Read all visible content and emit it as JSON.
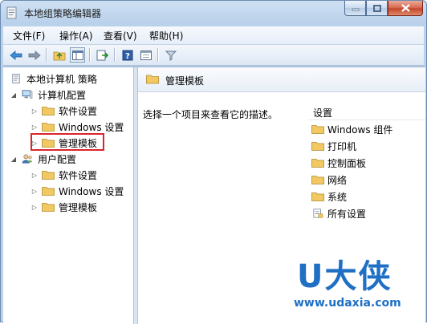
{
  "window": {
    "title": "本地组策略编辑器"
  },
  "menu": [
    {
      "label": "文件(F)"
    },
    {
      "label": "操作(A)"
    },
    {
      "label": "查看(V)"
    },
    {
      "label": "帮助(H)"
    }
  ],
  "toolbar": {
    "icons": [
      "back-arrow-icon",
      "forward-arrow-icon",
      "up-folder-icon",
      "show-hide-tree-icon",
      "export-list-icon",
      "help-icon",
      "properties-icon",
      "filter-icon"
    ]
  },
  "tree": {
    "root": "本地计算机 策略",
    "computer_config": "计算机配置",
    "computer_children": [
      "软件设置",
      "Windows 设置",
      "管理模板"
    ],
    "user_config": "用户配置",
    "user_children": [
      "软件设置",
      "Windows 设置",
      "管理模板"
    ]
  },
  "right": {
    "title": "管理模板",
    "description": "选择一个项目来查看它的描述。",
    "column_header": "设置",
    "items": [
      "Windows 组件",
      "打印机",
      "控制面板",
      "网络",
      "系统",
      "所有设置"
    ]
  },
  "watermark": {
    "big": "U大侠",
    "url": "www.udaxia.com"
  },
  "colors": {
    "highlight_border": "#d9252b",
    "folder": "#f2c862",
    "watermark": "#1f6fc4"
  }
}
